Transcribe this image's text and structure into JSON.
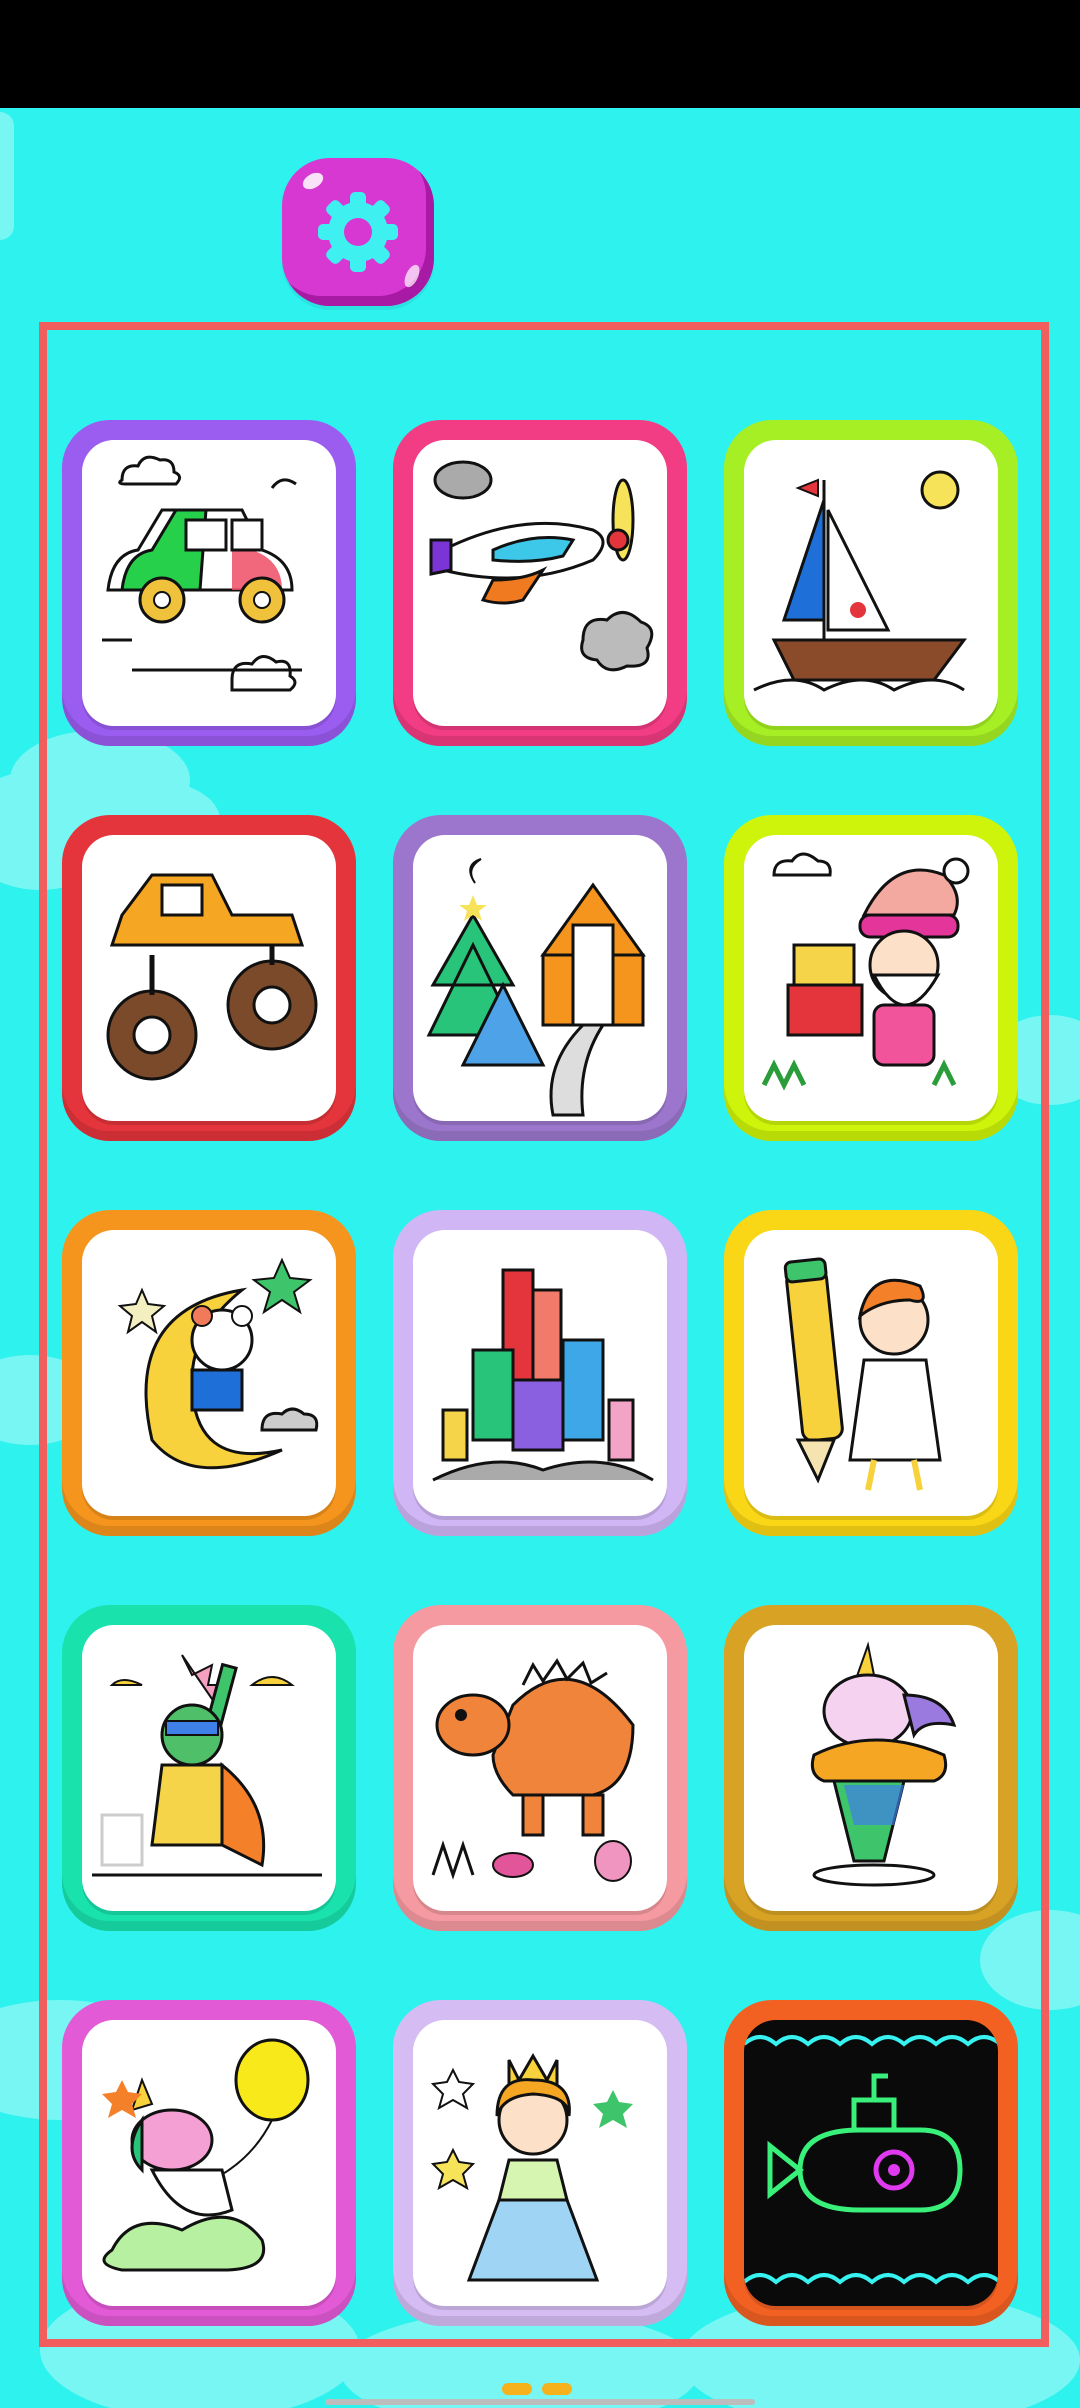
{
  "app": {
    "settings_icon": "gear-icon",
    "accent_color": "#2ef2ee",
    "frame_color": "#f25d5d"
  },
  "grid": {
    "cards": [
      {
        "name": "car",
        "icon": "car-icon",
        "border_color": "#9b5cf0"
      },
      {
        "name": "airplane",
        "icon": "airplane-icon",
        "border_color": "#f23c83"
      },
      {
        "name": "sailboat",
        "icon": "sailboat-icon",
        "border_color": "#a6ef24"
      },
      {
        "name": "monster-truck",
        "icon": "monster-truck-icon",
        "border_color": "#e3353b"
      },
      {
        "name": "winter-house",
        "icon": "house-icon",
        "border_color": "#9b76cc"
      },
      {
        "name": "santa",
        "icon": "santa-icon",
        "border_color": "#cdf40a"
      },
      {
        "name": "bear-moon",
        "icon": "bear-moon-icon",
        "border_color": "#f5951d"
      },
      {
        "name": "castle",
        "icon": "castle-icon",
        "border_color": "#d0b6f5"
      },
      {
        "name": "pencil-girl",
        "icon": "pencil-girl-icon",
        "border_color": "#f9d616"
      },
      {
        "name": "superhero",
        "icon": "superhero-icon",
        "border_color": "#19e2ad"
      },
      {
        "name": "dinosaur",
        "icon": "dinosaur-icon",
        "border_color": "#f59aa0"
      },
      {
        "name": "unicorn-cupcake",
        "icon": "unicorn-cupcake-icon",
        "border_color": "#d8a225"
      },
      {
        "name": "unicorn-balloon",
        "icon": "unicorn-balloon-icon",
        "border_color": "#e25ad6"
      },
      {
        "name": "princess",
        "icon": "princess-icon",
        "border_color": "#d5bdf4"
      },
      {
        "name": "glow-submarine",
        "icon": "submarine-icon",
        "border_color": "#f26022"
      }
    ]
  },
  "pager": {
    "dots": 2,
    "active_color": "#f5b21c"
  }
}
